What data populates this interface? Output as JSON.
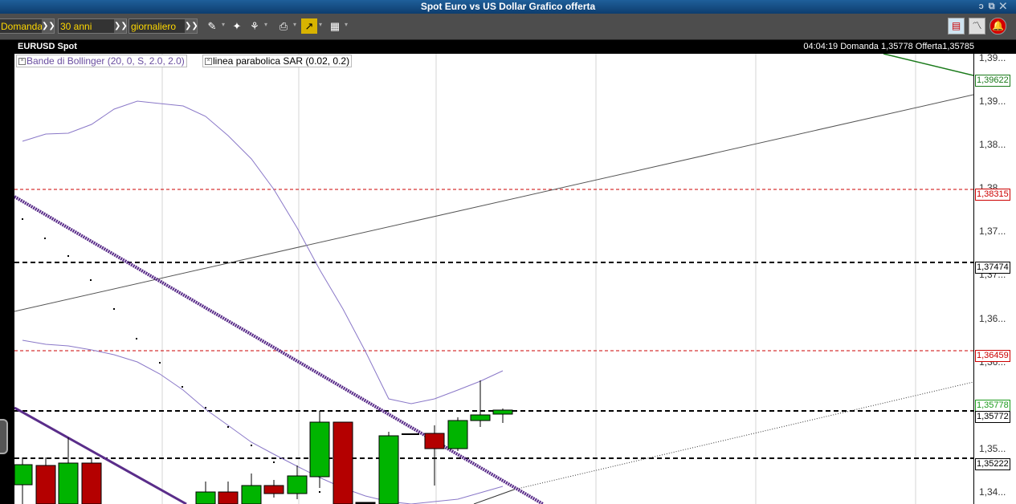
{
  "window": {
    "title": "Spot Euro vs US Dollar Grafico offerta"
  },
  "toolbar": {
    "price_type": "Domanda",
    "period": "30 anni",
    "interval": "giornaliero"
  },
  "header": {
    "symbol": "EURUSD Spot",
    "quote": "04:04:19  Domanda 1,35778  Offerta1,35785"
  },
  "indicators": [
    {
      "label": "Bande di Bollinger (20, 0, S, 2.0, 2.0)",
      "color": "#6a4ea0"
    },
    {
      "label": "linea parabolica SAR (0.02, 0.2)",
      "color": "#000000"
    }
  ],
  "axis": {
    "ticks": [
      "1,39...",
      "1,39...",
      "1,38...",
      "1,38...",
      "1,37...",
      "1,37...",
      "1,36...",
      "1,36...",
      "1,35...",
      "1,34..."
    ]
  },
  "price_levels": [
    {
      "value": "1,39622",
      "color": "#1a7a1a"
    },
    {
      "value": "1,38315",
      "color": "#cc0000"
    },
    {
      "value": "1,37474",
      "color": "#000000"
    },
    {
      "value": "1,36459",
      "color": "#cc0000"
    },
    {
      "value": "1,35778",
      "color": "#1a9a1a"
    },
    {
      "value": "1,35772",
      "color": "#000000"
    },
    {
      "value": "1,35222",
      "color": "#000000"
    }
  ],
  "colors": {
    "bull": "#00b400",
    "bear": "#b40000",
    "bollinger": "#8a78c8",
    "downtrend": "#5a2d8a"
  }
}
